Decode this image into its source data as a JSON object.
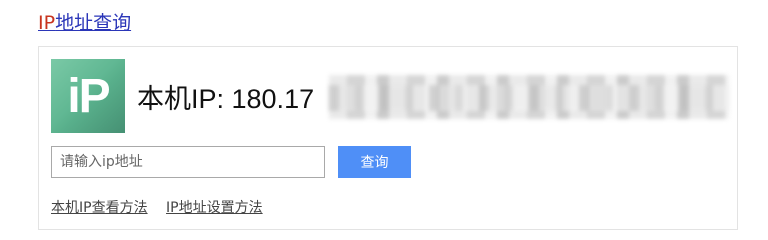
{
  "header": {
    "title_ip": "IP",
    "title_rest": "地址查询"
  },
  "card": {
    "logo_text": "iP",
    "ip_label": "本机IP: 180.17"
  },
  "search": {
    "placeholder": "请输入ip地址",
    "value": "",
    "button_label": "查询"
  },
  "links": [
    {
      "label": "本机IP查看方法"
    },
    {
      "label": "IP地址设置方法"
    }
  ],
  "colors": {
    "accent_blue": "#4f8ff7",
    "logo_green": "#5bb48f",
    "title_red": "#c8341e",
    "title_blue": "#2b36b8"
  }
}
